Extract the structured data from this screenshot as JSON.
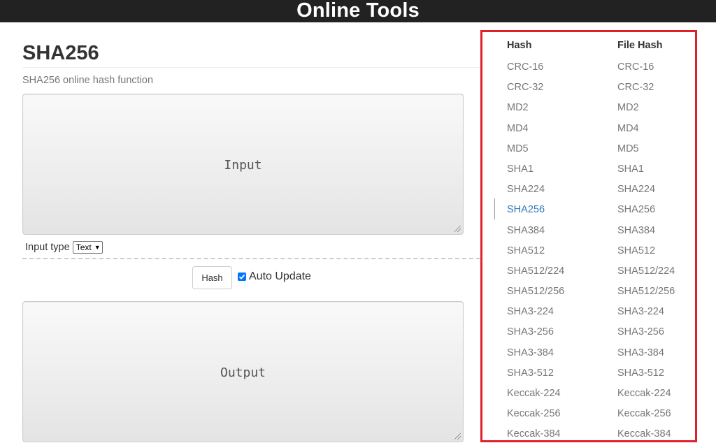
{
  "header": {
    "title": "Online Tools"
  },
  "page": {
    "title": "SHA256",
    "subtitle": "SHA256 online hash function"
  },
  "input": {
    "placeholder": "Input"
  },
  "input_type": {
    "label": "Input type",
    "selected": "Text"
  },
  "controls": {
    "hash_label": "Hash",
    "auto_update_label": "Auto Update",
    "auto_update_checked": true
  },
  "output": {
    "placeholder": "Output"
  },
  "sidebar": {
    "border_color": "#e2202a",
    "active_color": "#337ab7",
    "hash_header": "Hash",
    "file_hash_header": "File Hash",
    "hash_items": [
      "CRC-16",
      "CRC-32",
      "MD2",
      "MD4",
      "MD5",
      "SHA1",
      "SHA224",
      "SHA256",
      "SHA384",
      "SHA512",
      "SHA512/224",
      "SHA512/256",
      "SHA3-224",
      "SHA3-256",
      "SHA3-384",
      "SHA3-512",
      "Keccak-224",
      "Keccak-256",
      "Keccak-384"
    ],
    "file_hash_items": [
      "CRC-16",
      "CRC-32",
      "MD2",
      "MD4",
      "MD5",
      "SHA1",
      "SHA224",
      "SHA256",
      "SHA384",
      "SHA512",
      "SHA512/224",
      "SHA512/256",
      "SHA3-224",
      "SHA3-256",
      "SHA3-384",
      "SHA3-512",
      "Keccak-224",
      "Keccak-256",
      "Keccak-384"
    ],
    "active_hash_item": "SHA256"
  }
}
